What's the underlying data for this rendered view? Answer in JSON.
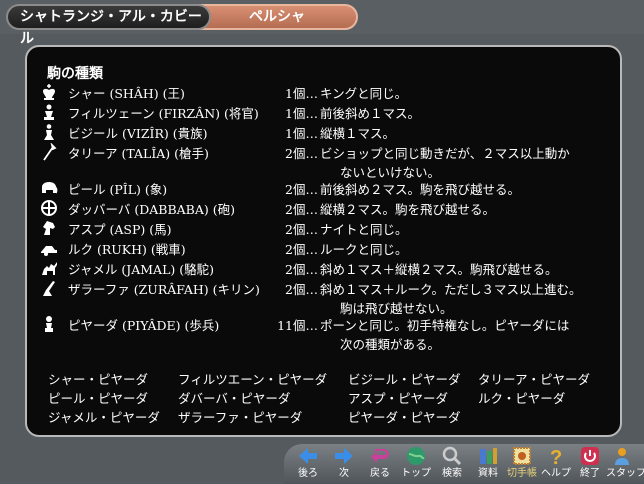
{
  "tabs": {
    "primary": "シャトランジ・アル・カビール",
    "secondary": "ペルシャ"
  },
  "heading": "駒の種類",
  "pieces": [
    {
      "icon": "king-piece-icon",
      "name": "シャー (SHÂH) (王)",
      "count": "1個…",
      "desc": "キングと同じ。"
    },
    {
      "icon": "general-piece-icon",
      "name": "フィルツェーン (FIRZÂN) (将官)",
      "count": "1個…",
      "desc": "前後斜め１マス。"
    },
    {
      "icon": "vizier-piece-icon",
      "name": "ビジール (VIZÎR) (貴族)",
      "count": "1個…",
      "desc": "縦横１マス。"
    },
    {
      "icon": "talia-piece-icon",
      "name": "タリーア (TALÎA) (槍手)",
      "count": "2個…",
      "desc": "ビショップと同じ動きだが、２マス以上動か",
      "desc2": "ないといけない。"
    },
    {
      "icon": "elephant-piece-icon",
      "name": "ピール (PÎL) (象)",
      "count": "2個…",
      "desc": "前後斜め２マス。駒を飛び越せる。"
    },
    {
      "icon": "dabbaba-piece-icon",
      "name": "ダッバーバ (DABBABA) (砲)",
      "count": "2個…",
      "desc": "縦横２マス。駒を飛び越せる。"
    },
    {
      "icon": "horse-piece-icon",
      "name": "アスプ (ASP) (馬)",
      "count": "2個…",
      "desc": "ナイトと同じ。"
    },
    {
      "icon": "chariot-piece-icon",
      "name": "ルク (RUKH) (戦車)",
      "count": "2個…",
      "desc": "ルークと同じ。"
    },
    {
      "icon": "camel-piece-icon",
      "name": "ジャメル (JAMAL) (駱駝)",
      "count": "2個…",
      "desc": "斜め１マス＋縦横２マス。駒飛び越せる。"
    },
    {
      "icon": "giraffe-piece-icon",
      "name": "ザラーファ (ZURÂFAH) (キリン)",
      "count": "2個…",
      "desc": "斜め１マス＋ルーク。ただし３マス以上進む。",
      "desc2": "駒は飛び越せない。"
    },
    {
      "icon": "pawn-piece-icon",
      "name": "ピヤーダ (PIYÂDE) (歩兵)",
      "count": "11個…",
      "desc": "ポーンと同じ。初手特権なし。ピヤーダには",
      "desc2": "次の種類がある。"
    }
  ],
  "pawn_types": [
    [
      "シャー・ピヤーダ",
      "フィルツエーン・ピヤーダ",
      "ビジール・ピヤーダ",
      "タリーア・ピヤーダ"
    ],
    [
      "ピール・ピヤーダ",
      "ダバーバ・ピヤーダ",
      "アスプ・ピヤーダ",
      "ルク・ピヤーダ"
    ],
    [
      "ジャメル・ピヤーダ",
      "ザラーファ・ピヤーダ",
      "ピヤーダ・ピヤーダ",
      ""
    ]
  ],
  "nav": [
    {
      "name": "back",
      "label": "後ろ",
      "icon": "left-arrow-icon",
      "color": "#3a8ee8"
    },
    {
      "name": "next",
      "label": "次",
      "icon": "right-arrow-icon",
      "color": "#3a8ee8"
    },
    {
      "name": "return",
      "label": "戻る",
      "icon": "return-arrow-icon",
      "color": "#c8409a"
    },
    {
      "name": "top",
      "label": "トップ",
      "icon": "globe-icon",
      "color": "#2e9a6a"
    },
    {
      "name": "search",
      "label": "検索",
      "icon": "magnifier-icon",
      "color": "#cccccc"
    },
    {
      "name": "materials",
      "label": "資料",
      "icon": "books-icon",
      "color": "#4a7ad0"
    },
    {
      "name": "kirifuda",
      "label": "切手帳",
      "icon": "stamp-icon",
      "color": "#f0e0a0"
    },
    {
      "name": "help",
      "label": "ヘルプ",
      "icon": "question-icon",
      "color": "#e8b030"
    },
    {
      "name": "quit",
      "label": "終了",
      "icon": "power-icon",
      "color": "#d03050"
    },
    {
      "name": "staff",
      "label": "スタッフ",
      "icon": "staff-icon",
      "color": "#e8a020"
    }
  ]
}
